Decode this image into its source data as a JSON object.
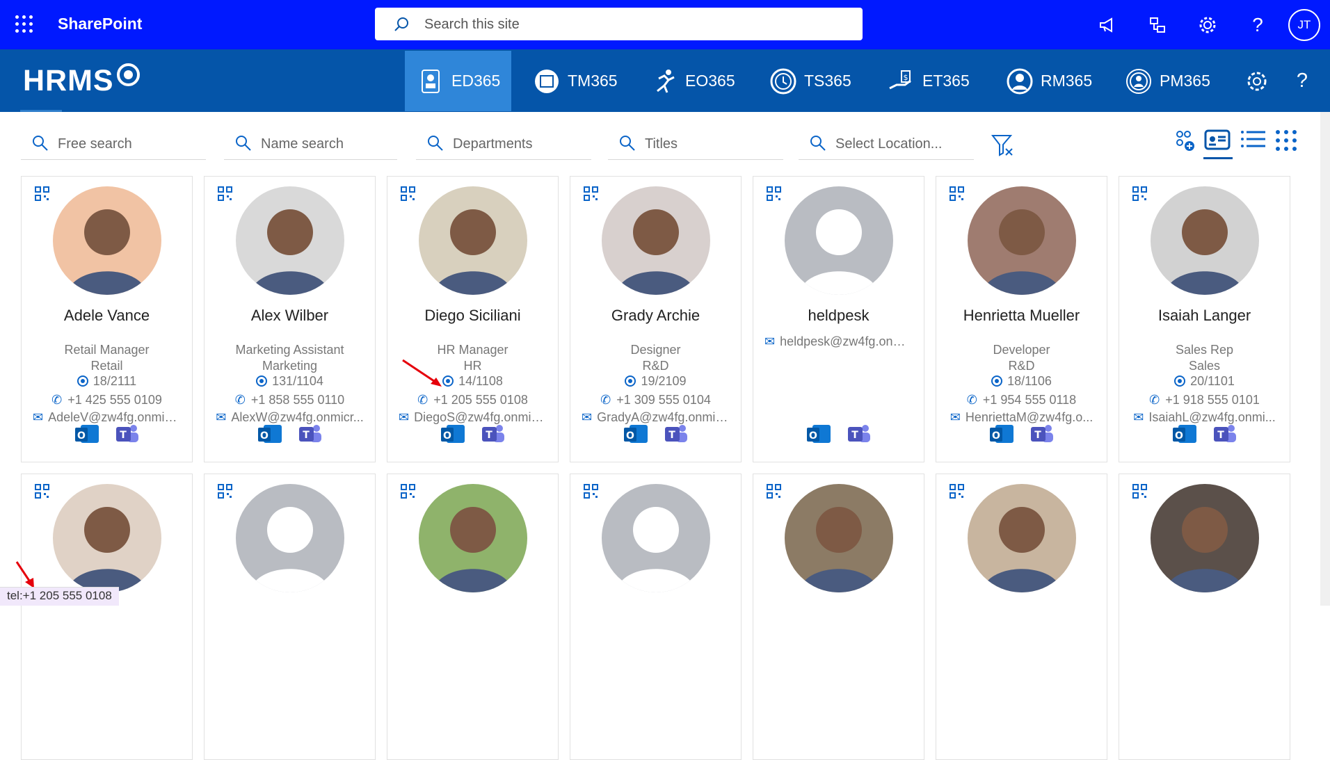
{
  "topbar": {
    "title": "SharePoint",
    "search_placeholder": "Search this site",
    "avatar": "JT",
    "icons": [
      "megaphone-icon",
      "share-icon",
      "settings-gear-icon",
      "help-icon"
    ]
  },
  "hrms": {
    "logo_text": "HRMS",
    "nav": [
      {
        "label": "ED365",
        "icon": "employee-directory-icon",
        "active": true
      },
      {
        "label": "TM365",
        "icon": "team-monitor-icon"
      },
      {
        "label": "EO365",
        "icon": "runner-icon"
      },
      {
        "label": "TS365",
        "icon": "clock-icon"
      },
      {
        "label": "ET365",
        "icon": "expense-hand-icon"
      },
      {
        "label": "RM365",
        "icon": "person-circle-icon"
      },
      {
        "label": "PM365",
        "icon": "person-badge-icon"
      }
    ]
  },
  "filters": {
    "free": "Free search",
    "name": "Name search",
    "departments": "Departments",
    "titles": "Titles",
    "location": "Select Location..."
  },
  "people": [
    {
      "name": "Adele Vance",
      "title": "Retail Manager",
      "dept": "Retail",
      "office": "18/2111",
      "phone": "+1 425 555 0109",
      "email": "AdeleV@zw4fg.onmic..."
    },
    {
      "name": "Alex Wilber",
      "title": "Marketing Assistant",
      "dept": "Marketing",
      "office": "131/1104",
      "phone": "+1 858 555 0110",
      "email": "AlexW@zw4fg.onmicr..."
    },
    {
      "name": "Diego Siciliani",
      "title": "HR Manager",
      "dept": "HR",
      "office": "14/1108",
      "phone": "+1 205 555 0108",
      "email": "DiegoS@zw4fg.onmic..."
    },
    {
      "name": "Grady Archie",
      "title": "Designer",
      "dept": "R&D",
      "office": "19/2109",
      "phone": "+1 309 555 0104",
      "email": "GradyA@zw4fg.onmic..."
    },
    {
      "name": "heldpesk",
      "title": "",
      "dept": "",
      "office": "",
      "phone": "",
      "email": "heldpesk@zw4fg.onm..."
    },
    {
      "name": "Henrietta Mueller",
      "title": "Developer",
      "dept": "R&D",
      "office": "18/1106",
      "phone": "+1 954 555 0118",
      "email": "HenriettaM@zw4fg.o..."
    },
    {
      "name": "Isaiah Langer",
      "title": "Sales Rep",
      "dept": "Sales",
      "office": "20/1101",
      "phone": "+1 918 555 0101",
      "email": "IsaiahL@zw4fg.onmi..."
    }
  ],
  "status_link": "tel:+1 205 555 0108",
  "colors": {
    "sharepoint_blue": "#0019ff",
    "hrms_blue": "#0555a9",
    "accent": "#0a64c8"
  }
}
